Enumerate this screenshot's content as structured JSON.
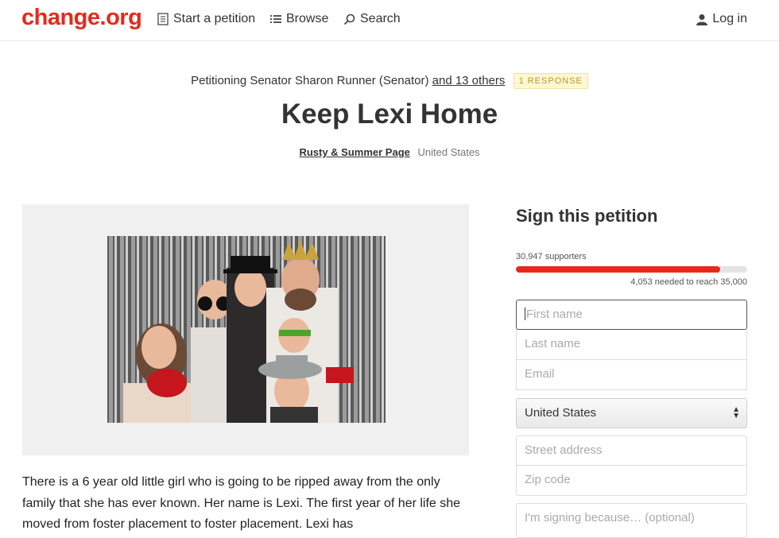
{
  "header": {
    "logo": "change.org",
    "nav": {
      "start": "Start a petition",
      "browse": "Browse",
      "search": "Search",
      "login": "Log in"
    }
  },
  "petition": {
    "petitioning_prefix": "Petitioning Senator Sharon Runner (Senator)",
    "others_link": "and 13 others",
    "response_badge": "1 RESPONSE",
    "title": "Keep Lexi Home",
    "author": "Rusty & Summer Page",
    "location": "United States",
    "body": "There is a 6 year old little girl who is going to be ripped away from the only family that she has ever known. Her name is Lexi. The first year of her life she moved from foster placement to foster placement. Lexi has"
  },
  "sign": {
    "title": "Sign this petition",
    "supporters": "30,947 supporters",
    "needed": "4,053 needed to reach 35,000",
    "progress_fraction": 0.884,
    "fields": {
      "first_name": "First name",
      "last_name": "Last name",
      "email": "Email",
      "country": "United States",
      "street": "Street address",
      "zip": "Zip code",
      "reason": "I'm signing because… (optional)"
    }
  },
  "colors": {
    "brand": "#e42a1c",
    "badge_bg": "#fdf7d3"
  }
}
